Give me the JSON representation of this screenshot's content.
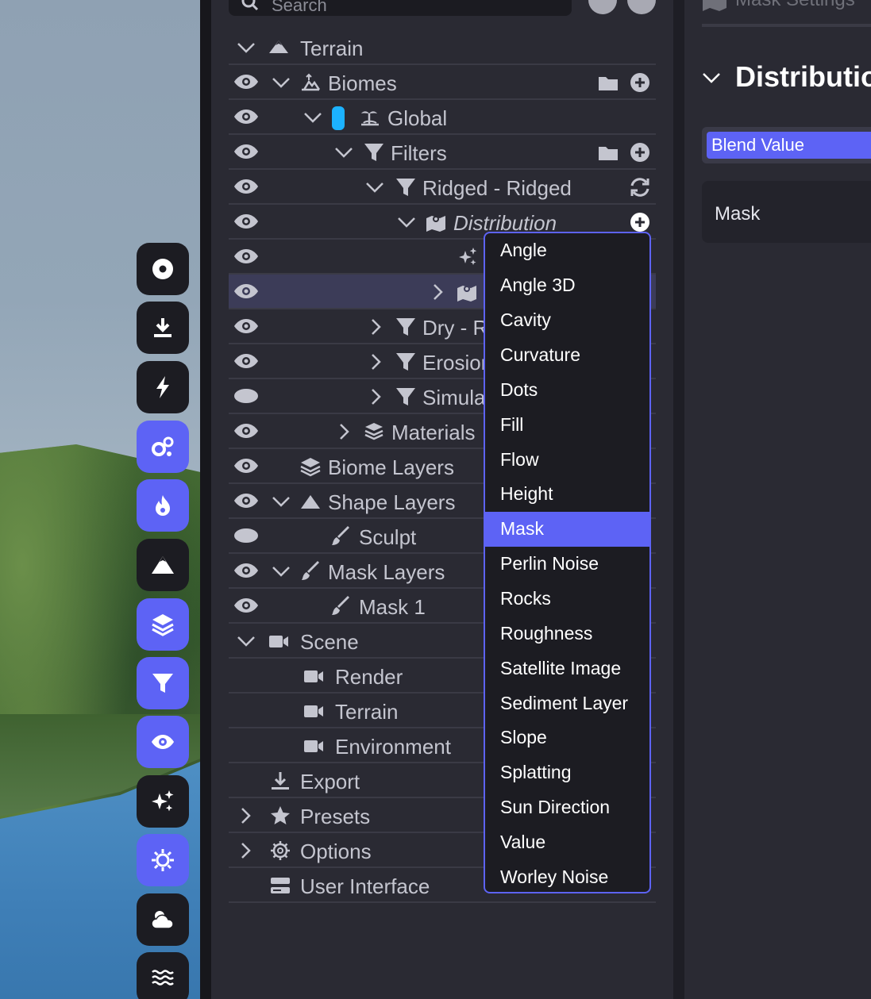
{
  "outliner": {
    "search_placeholder": "Search",
    "rows": [
      {
        "label": "Terrain"
      },
      {
        "label": "Biomes"
      },
      {
        "label": "Global"
      },
      {
        "label": "Filters"
      },
      {
        "label": "Ridged - Ridged"
      },
      {
        "label": "Distribution"
      },
      {
        "label": ""
      },
      {
        "label": ""
      },
      {
        "label": "Dry - R"
      },
      {
        "label": "Erosior"
      },
      {
        "label": "Simula"
      },
      {
        "label": "Materials"
      },
      {
        "label": "Biome Layers"
      },
      {
        "label": "Shape Layers"
      },
      {
        "label": "Sculpt"
      },
      {
        "label": "Mask Layers"
      },
      {
        "label": "Mask 1"
      },
      {
        "label": "Scene"
      },
      {
        "label": "Render"
      },
      {
        "label": "Terrain"
      },
      {
        "label": "Environment"
      },
      {
        "label": "Export"
      },
      {
        "label": "Presets"
      },
      {
        "label": "Options"
      },
      {
        "label": "User Interface"
      }
    ]
  },
  "dropdown": {
    "selected": "Mask",
    "options": [
      "Angle",
      "Angle 3D",
      "Cavity",
      "Curvature",
      "Dots",
      "Fill",
      "Flow",
      "Height",
      "Mask",
      "Perlin Noise",
      "Rocks",
      "Roughness",
      "Satellite Image",
      "Sediment Layer",
      "Slope",
      "Splatting",
      "Sun Direction",
      "Value",
      "Worley Noise"
    ]
  },
  "settings": {
    "header": "Mask Settings",
    "section_title": "Distributio",
    "blend_value": "Blend Value",
    "mask_label": "Mask"
  },
  "toolbar": {
    "buttons": [
      "record-icon",
      "download-icon",
      "bolt-icon",
      "gears-icon",
      "fire-icon",
      "mountain-icon",
      "layers-icon",
      "filter-icon",
      "eye-icon",
      "sparkles-icon",
      "sun-icon",
      "cloud-sun-icon",
      "water-icon"
    ]
  },
  "colors": {
    "accent": "#5d63f5",
    "panel": "#2a2a33",
    "biome_pill": "#1cb2ff"
  }
}
